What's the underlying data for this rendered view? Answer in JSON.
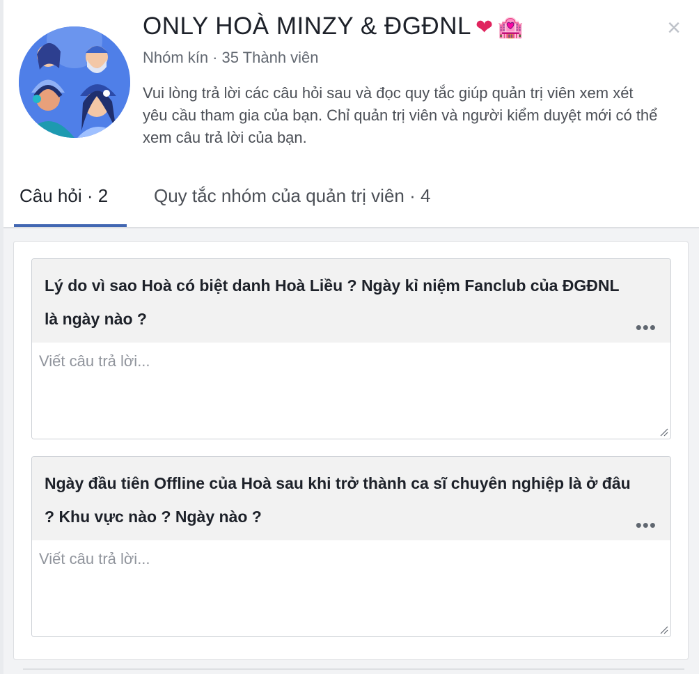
{
  "group": {
    "title": "ONLY HOÀ MINZY & ĐGĐNL",
    "title_emoji_heart": "❤",
    "title_emoji_hotel": "🏩",
    "privacy": "Nhóm kín",
    "separator": "·",
    "members": "35 Thành viên",
    "description": "Vui lòng trả lời các câu hỏi sau và đọc quy tắc giúp quản trị viên xem xét yêu cầu tham gia của bạn. Chỉ quản trị viên và người kiểm duyệt mới có thể xem câu trả lời của bạn."
  },
  "close_label": "×",
  "tabs": [
    {
      "label": "Câu hỏi · 2",
      "active": true
    },
    {
      "label": "Quy tắc nhóm của quản trị viên · 4",
      "active": false
    }
  ],
  "questions": [
    {
      "text": "Lý do vì sao Hoà có biệt danh Hoà Liều ? Ngày kỉ niệm Fanclub của ĐGĐNL là ngày nào ?",
      "more_label": "•••",
      "placeholder": "Viết câu trả lời..."
    },
    {
      "text": "Ngày đầu tiên Offline của Hoà sau khi trở thành ca sĩ chuyên nghiệp là ở đâu ? Khu vực nào ? Ngày nào ?",
      "more_label": "•••",
      "placeholder": "Viết câu trả lời..."
    }
  ],
  "colors": {
    "accent": "#4267b2",
    "avatar_bg": "#4f7fe8",
    "question_bg": "#f2f2f2",
    "content_bg": "#f2f3f5"
  }
}
